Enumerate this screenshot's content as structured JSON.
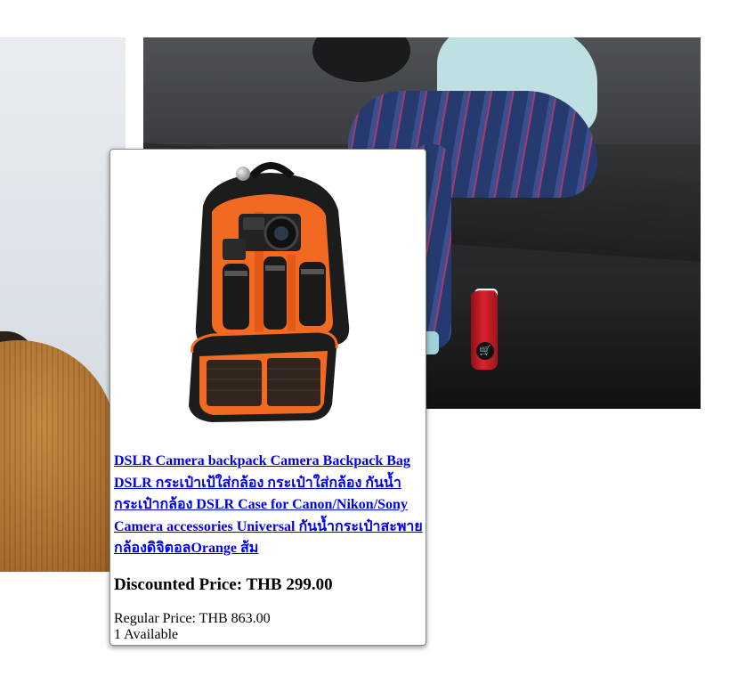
{
  "background": {
    "left_photo": "person-in-corduroy-jacket",
    "right_photo": "runner-tying-shoe-on-steps",
    "cart_icon": "🛒"
  },
  "product": {
    "title": "DSLR Camera backpack Camera Backpack Bag DSLR กระเป๋าเป้ใส่กล้อง กระเป๋าใส่กล้อง กันน้ำ กระเป๋ากล้อง DSLR Case for Canon/Nikon/Sony Camera accessories Universal กันน้ำกระเป๋าสะพายกล้องดิจิตอลOrange ส้ม",
    "discounted_price": "Discounted Price: THB 299.00",
    "regular_price": "Regular Price: THB 863.00",
    "availability": "1 Available",
    "colors": {
      "accent": "#f26a21",
      "link": "#0000ee"
    }
  }
}
